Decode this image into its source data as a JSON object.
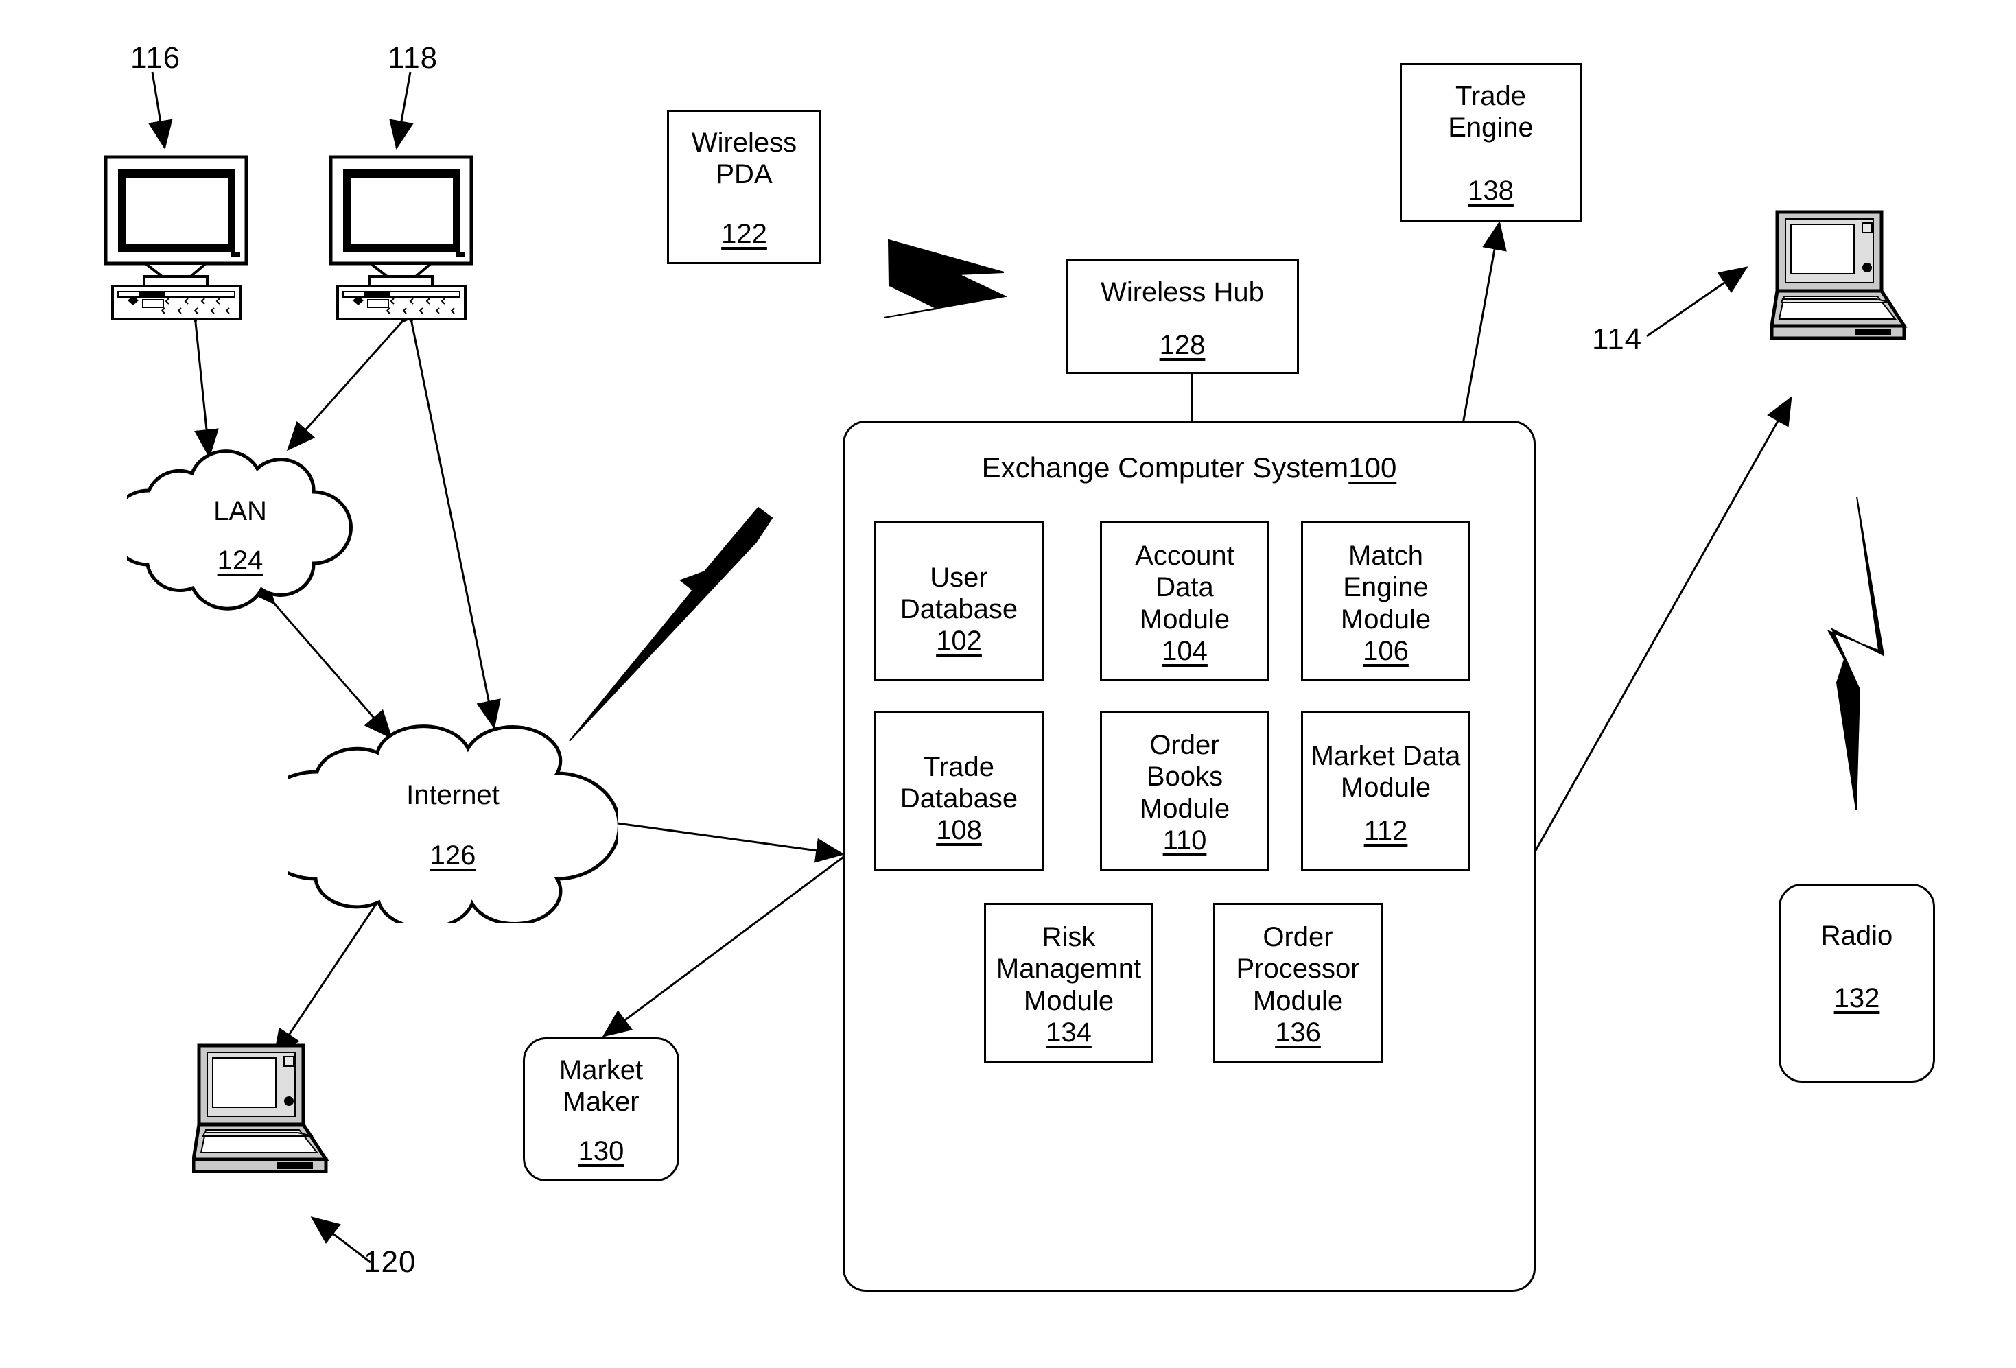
{
  "figure": {
    "background": "#ffffff",
    "stroke": "#000000"
  },
  "exchange_system": {
    "title_text": "Exchange Computer System",
    "title_ref": "100",
    "modules": [
      {
        "label": "User\nDatabase",
        "ref": "102",
        "name": "user-database"
      },
      {
        "label": "Account\nData\nModule",
        "ref": "104",
        "name": "account-data-module"
      },
      {
        "label": "Match\nEngine\nModule",
        "ref": "106",
        "name": "match-engine-module"
      },
      {
        "label": "Trade\nDatabase",
        "ref": "108",
        "name": "trade-database"
      },
      {
        "label": "Order\nBooks\nModule",
        "ref": "110",
        "name": "order-books-module"
      },
      {
        "label": "Market Data\nModule",
        "ref": "112",
        "name": "market-data-module"
      },
      {
        "label": "Risk\nManagemnt\nModule",
        "ref": "134",
        "name": "risk-management-module"
      },
      {
        "label": "Order\nProcessor\nModule",
        "ref": "136",
        "name": "order-processor-module"
      }
    ]
  },
  "nodes": {
    "wireless_pda": {
      "label": "Wireless\nPDA",
      "ref": "122"
    },
    "trade_engine": {
      "label": "Trade\nEngine",
      "ref": "138"
    },
    "wireless_hub": {
      "label": "Wireless Hub",
      "ref": "128"
    },
    "market_maker": {
      "label": "Market\nMaker",
      "ref": "130"
    },
    "radio": {
      "label": "Radio",
      "ref": "132"
    },
    "lan": {
      "label": "LAN",
      "ref": "124"
    },
    "internet": {
      "label": "Internet",
      "ref": "126"
    }
  },
  "callouts": {
    "workstation_1": "116",
    "workstation_2": "118",
    "laptop_left": "120",
    "laptop_right": "114"
  }
}
